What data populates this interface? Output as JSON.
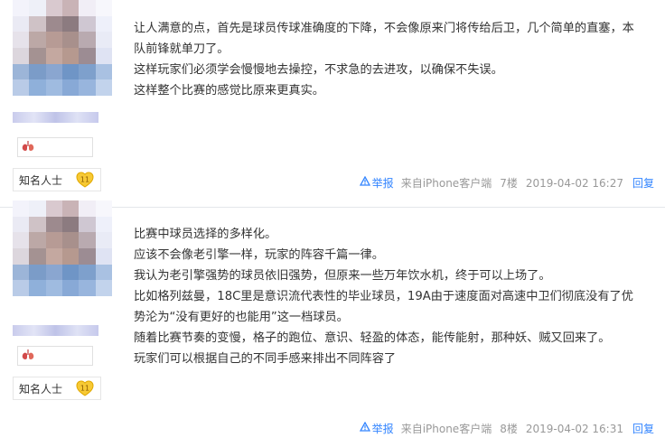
{
  "posts": [
    {
      "author_title": "知名人士",
      "level": "11",
      "paragraphs": [
        "让人满意的点，首先是球员传球准确度的下降，不会像原来门将传给后卫，几个简单的直塞，本队前锋就单刀了。",
        "这样玩家们必须学会慢慢地去操控，不求急的去进攻，以确保不失误。",
        "这样整个比赛的感觉比原来更真实。"
      ],
      "tail": {
        "report": "举报",
        "source": "来自iPhone客户端",
        "floor": "7楼",
        "time": "2019-04-02 16:27",
        "reply": "回复"
      }
    },
    {
      "author_title": "知名人士",
      "level": "11",
      "paragraphs": [
        "比赛中球员选择的多样化。",
        "应该不会像老引擎一样，玩家的阵容千篇一律。",
        "我认为老引擎强势的球员依旧强势，但原来一些万年饮水机，终于可以上场了。",
        "比如格列兹曼，18C里是意识流代表性的毕业球员，19A由于速度面对高速中卫们彻底没有了优势沦为“没有更好的也能用”这一档球员。",
        "随着比赛节奏的变慢，格子的跑位、意识、轻盈的体态，能传能射，那种妖、贼又回来了。",
        "玩家们可以根据自己的不同手感来排出不同阵容了"
      ],
      "tail": {
        "report": "举报",
        "source": "来自iPhone客户端",
        "floor": "8楼",
        "time": "2019-04-02 16:31",
        "reply": "回复"
      }
    }
  ],
  "icons": {
    "report": "report-icon",
    "badge": "lungs-badge-icon",
    "level": "heart-level-icon"
  },
  "colors": {
    "link": "#3385ff",
    "meta": "#999999",
    "level_badge": "#f5c518"
  }
}
